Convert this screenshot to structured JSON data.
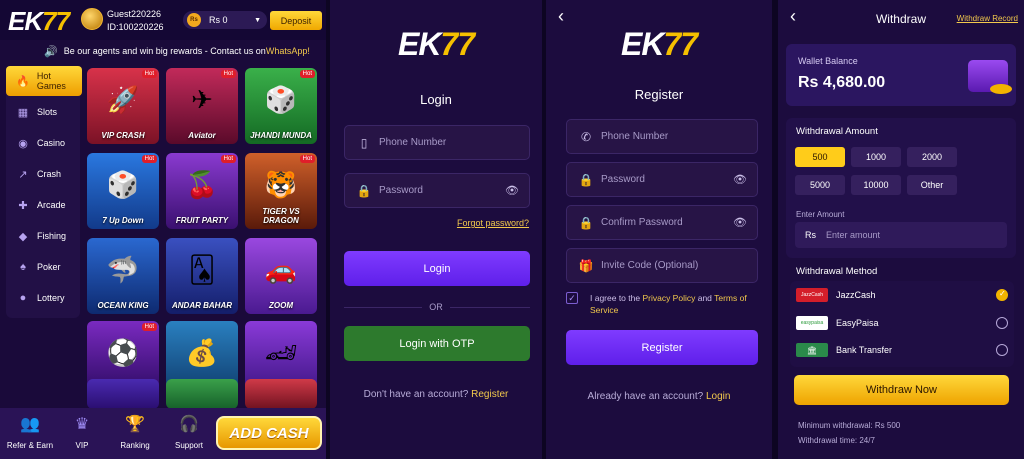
{
  "lobby": {
    "logo": {
      "main": "EK",
      "accent": "77"
    },
    "user": {
      "name": "Guest220226",
      "id": "ID:100220226"
    },
    "balance": {
      "currency": "Rs",
      "value": "0"
    },
    "deposit_label": "Deposit",
    "marquee": {
      "text": "Be our agents and win big rewards - Contact us on ",
      "link": "WhatsApp!"
    },
    "sidebar": [
      {
        "label": "Hot Games",
        "icon": "fire-icon"
      },
      {
        "label": "Slots",
        "icon": "slots-icon"
      },
      {
        "label": "Casino",
        "icon": "chips-icon"
      },
      {
        "label": "Crash",
        "icon": "chart-icon"
      },
      {
        "label": "Arcade",
        "icon": "gamepad-icon"
      },
      {
        "label": "Fishing",
        "icon": "fish-icon"
      },
      {
        "label": "Poker",
        "icon": "cards-icon"
      },
      {
        "label": "Lottery",
        "icon": "ball-icon"
      }
    ],
    "games": [
      {
        "title": "VIP CRASH",
        "hot": "Hot",
        "bg": "#c42a3c"
      },
      {
        "title": "Aviator",
        "hot": "Hot",
        "bg": "#8a1a2a"
      },
      {
        "title": "JHANDI MUNDA",
        "hot": "Hot",
        "bg": "#2a8a3a"
      },
      {
        "title": "7 Up Down",
        "hot": "Hot",
        "bg": "#1a5fc0"
      },
      {
        "title": "FRUIT PARTY",
        "hot": "Hot",
        "bg": "#7a2ab0"
      },
      {
        "title": "TIGER VS DRAGON",
        "hot": "Hot",
        "bg": "#b0401a"
      },
      {
        "title": "OCEAN KING",
        "hot": "",
        "bg": "#1a4fb0"
      },
      {
        "title": "ANDAR BAHAR",
        "hot": "",
        "bg": "#2a3aa0"
      },
      {
        "title": "ZOOM",
        "hot": "",
        "bg": "#7a30c0"
      },
      {
        "title": "",
        "hot": "Hot",
        "bg": "#5a20a0"
      },
      {
        "title": "",
        "hot": "",
        "bg": "#1a60a0"
      },
      {
        "title": "",
        "hot": "",
        "bg": "#6a2ab8"
      },
      {
        "title": "",
        "hot": "",
        "bg": "#3a1a8a"
      },
      {
        "title": "",
        "hot": "",
        "bg": "#2a8a3a"
      },
      {
        "title": "",
        "hot": "",
        "bg": "#c03040"
      }
    ],
    "bottom_nav": [
      {
        "label": "Refer & Earn",
        "icon": "refer-icon"
      },
      {
        "label": "VIP",
        "icon": "crown-icon"
      },
      {
        "label": "Ranking",
        "icon": "trophy-icon"
      },
      {
        "label": "Support",
        "icon": "headset-icon"
      }
    ],
    "add_cash": "ADD CASH"
  },
  "login": {
    "logo": {
      "main": "EK",
      "accent": "77"
    },
    "title": "Login",
    "phone_placeholder": "Phone Number",
    "password_placeholder": "Password",
    "forgot": "Forgot password?",
    "login_button": "Login",
    "or": "OR",
    "otp_button": "Login with OTP",
    "no_account": "Don't have an account?",
    "register_link": "Register"
  },
  "register": {
    "logo": {
      "main": "EK",
      "accent": "77"
    },
    "title": "Register",
    "phone_placeholder": "Phone Number",
    "password_placeholder": "Password",
    "confirm_placeholder": "Confirm Password",
    "invite_placeholder": "Invite Code (Optional)",
    "agree_prefix": "I agree to the ",
    "privacy": "Privacy Policy",
    "and": " and ",
    "terms": "Terms of",
    "service": "Service",
    "register_button": "Register",
    "have_account": "Already have an account?",
    "login_link": "Login"
  },
  "withdraw": {
    "title": "Withdraw",
    "record_link": "Withdraw Record",
    "wallet_label": "Wallet Balance",
    "wallet_value": "Rs 4,680.00",
    "amount_label": "Withdrawal Amount",
    "amounts": [
      "500",
      "1000",
      "2000",
      "5000",
      "10000",
      "Other"
    ],
    "selected_amount": "500",
    "enter_label": "Enter Amount",
    "enter_currency": "Rs",
    "enter_placeholder": "Enter amount",
    "method_label": "Withdrawal Method",
    "methods": [
      {
        "name": "JazzCash",
        "logo_text": "JazzCash",
        "selected": true
      },
      {
        "name": "EasyPaisa",
        "logo_text": "easypaisa",
        "selected": false
      },
      {
        "name": "Bank Transfer",
        "logo_text": "",
        "selected": false
      }
    ],
    "withdraw_button": "Withdraw Now",
    "min_note": "Minimum withdrawal: Rs 500",
    "time_note": "Withdrawal time: 24/7"
  },
  "colors": {
    "accent_yellow": "#ffcc1a",
    "primary_purple": "#6f2bf5",
    "otp_green": "#2d7a2d",
    "bg": "#1c0c3e"
  }
}
